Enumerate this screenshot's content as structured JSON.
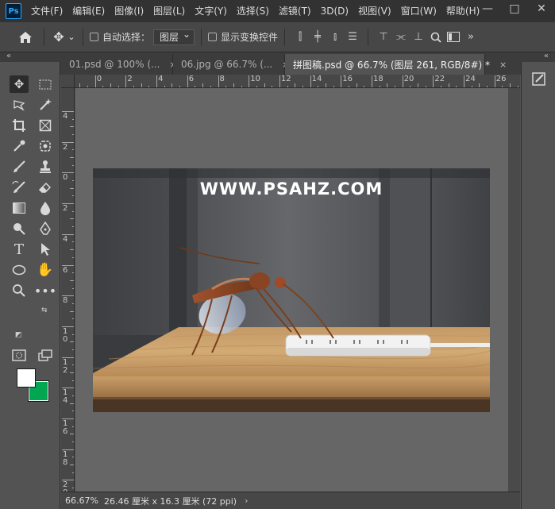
{
  "app": {
    "logo_text": "Ps"
  },
  "menu": [
    "文件(F)",
    "编辑(E)",
    "图像(I)",
    "图层(L)",
    "文字(Y)",
    "选择(S)",
    "滤镜(T)",
    "3D(D)",
    "视图(V)",
    "窗口(W)",
    "帮助(H)"
  ],
  "window_controls": {
    "minimize": "—",
    "maximize": "□",
    "close": "✕"
  },
  "options": {
    "auto_select_label": "自动选择：",
    "layer_select_value": "图层",
    "show_transform_label": "显示变换控件",
    "more": "»"
  },
  "panel_collapse": {
    "left": "«",
    "right": "«"
  },
  "tabs": [
    {
      "label": "01.psd @ 100% (...",
      "close": "×"
    },
    {
      "label": "06.jpg @ 66.7% (...",
      "close": "×"
    },
    {
      "label": "拼图稿.psd @ 66.7% (图层 261, RGB/8#) *",
      "close": "×"
    }
  ],
  "ruler": {
    "top_labels": [
      "2",
      "0",
      "2",
      "4",
      "6",
      "8",
      "10",
      "12",
      "14",
      "16",
      "18",
      "20",
      "22",
      "24",
      "26"
    ],
    "left_labels": [
      "4",
      "2",
      "0",
      "2",
      "4",
      "6",
      "8",
      "1 0",
      "1 2",
      "1 4",
      "1 6",
      "1 8",
      "2 0"
    ]
  },
  "document": {
    "watermark": "WWW.PSAHZ.COM"
  },
  "status": {
    "zoom": "66.67%",
    "doc_size": "26.46 厘米 x 16.3 厘米 (72 ppi)",
    "arrow": "›"
  },
  "colors": {
    "foreground": "#ffffff",
    "background": "#00a651",
    "accent": "#31a8ff"
  },
  "tools": [
    "move-tool-icon",
    "marquee-tool-icon",
    "lasso-tool-icon",
    "magic-wand-icon",
    "crop-tool-icon",
    "frame-tool-icon",
    "eyedropper-icon",
    "patch-tool-icon",
    "brush-icon",
    "stamp-icon",
    "history-brush-icon",
    "eraser-icon",
    "gradient-icon",
    "blur-icon",
    "dodge-icon",
    "pen-icon",
    "type-tool-icon",
    "path-selection-icon",
    "ellipse-icon",
    "hand-icon",
    "zoom-icon",
    "more-tools-icon",
    "quick-mask-icon",
    "screen-mode-icon"
  ]
}
